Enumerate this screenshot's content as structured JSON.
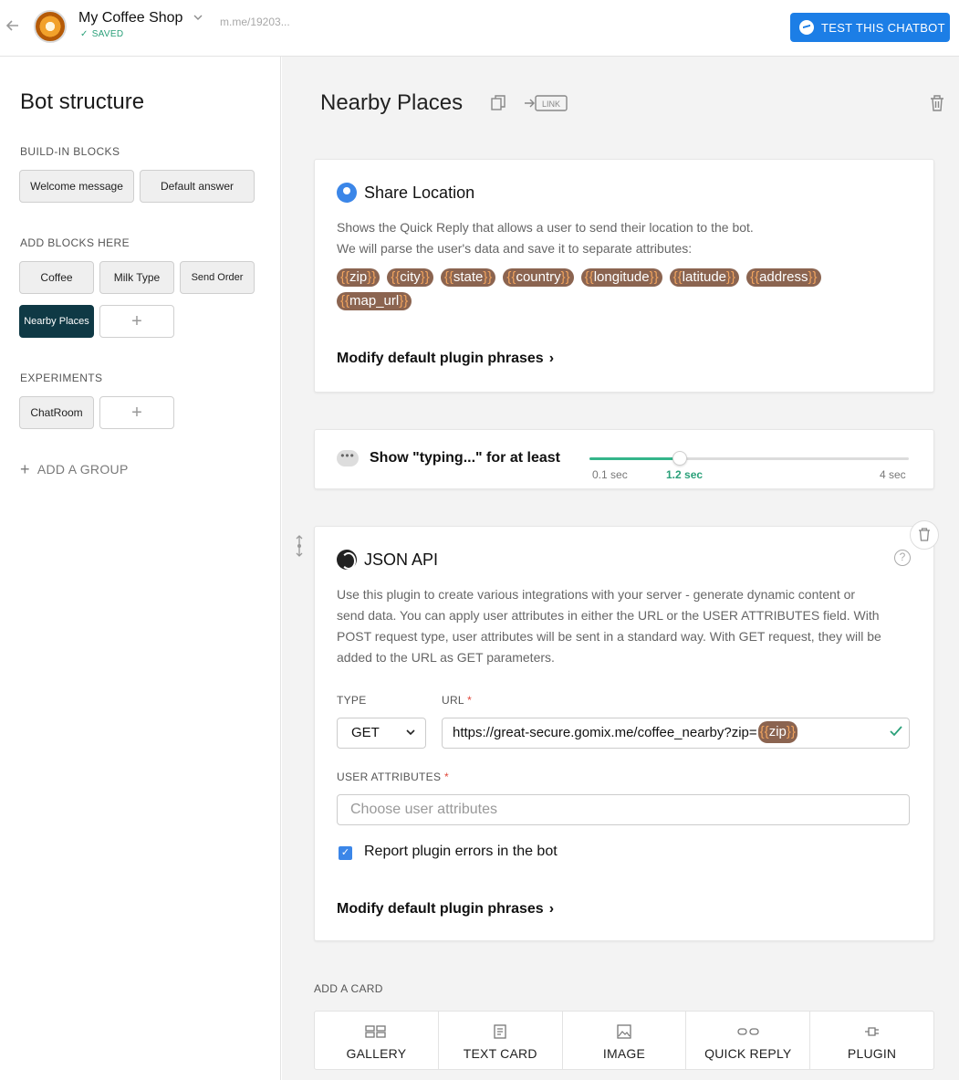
{
  "topbar": {
    "shop_name": "My Coffee Shop",
    "saved_label": "SAVED",
    "shop_link": "m.me/19203...",
    "test_button": "TEST THIS CHATBOT"
  },
  "sidebar": {
    "title": "Bot structure",
    "sections": {
      "builtin": "BUILD-IN BLOCKS",
      "add_blocks": "ADD BLOCKS HERE",
      "experiments": "EXPERIMENTS"
    },
    "builtin_blocks": [
      "Welcome message",
      "Default answer"
    ],
    "blocks": [
      "Coffee",
      "Milk Type",
      "Send Order",
      "Nearby Places"
    ],
    "experiments": [
      "ChatRoom"
    ],
    "add_block": "+",
    "add_group": "ADD A GROUP"
  },
  "main": {
    "page_title": "Nearby Places",
    "link_label": "LINK",
    "share_location": {
      "title": "Share Location",
      "desc1": "Shows the Quick Reply that allows a user to send their location to the bot.",
      "desc2": "We will parse the user's data and save it to separate attributes:",
      "attributes": [
        "zip",
        "city",
        "state",
        "country",
        "longitude",
        "latitude",
        "address",
        "map_url"
      ],
      "modify": "Modify default plugin phrases"
    },
    "typing": {
      "label": "Show \"typing...\" for at least",
      "min": "0.1 sec",
      "current": "1.2 sec",
      "max": "4 sec",
      "value_sec": 1.2,
      "min_sec": 0.1,
      "max_sec": 4
    },
    "json_api": {
      "title": "JSON API",
      "desc1": "Use this plugin to create various integrations with your server - generate dynamic content or",
      "desc2": "send data. You can apply user attributes in either the URL or the USER ATTRIBUTES field. With",
      "desc3": "POST request type, user attributes will be sent in a standard way. With GET request, they will be",
      "desc4": "added to the URL as GET parameters.",
      "type_label": "TYPE",
      "type_value": "GET",
      "url_label": "URL",
      "url_value": "https://great-secure.gomix.me/coffee_nearby?zip=",
      "url_attr": "zip",
      "attrs_label": "USER ATTRIBUTES",
      "attrs_placeholder": "Choose user attributes",
      "report_errors": "Report plugin errors in the bot",
      "report_checked": true,
      "modify": "Modify default plugin phrases"
    },
    "add_card_label": "ADD A CARD",
    "card_types": [
      "GALLERY",
      "TEXT CARD",
      "IMAGE",
      "QUICK REPLY",
      "PLUGIN"
    ]
  },
  "colors": {
    "accent": "#1c7ee6",
    "active_block": "#0f3945",
    "attr_tag": "#8b6450",
    "attr_brace": "#f0a35e",
    "success": "#2aa079"
  }
}
